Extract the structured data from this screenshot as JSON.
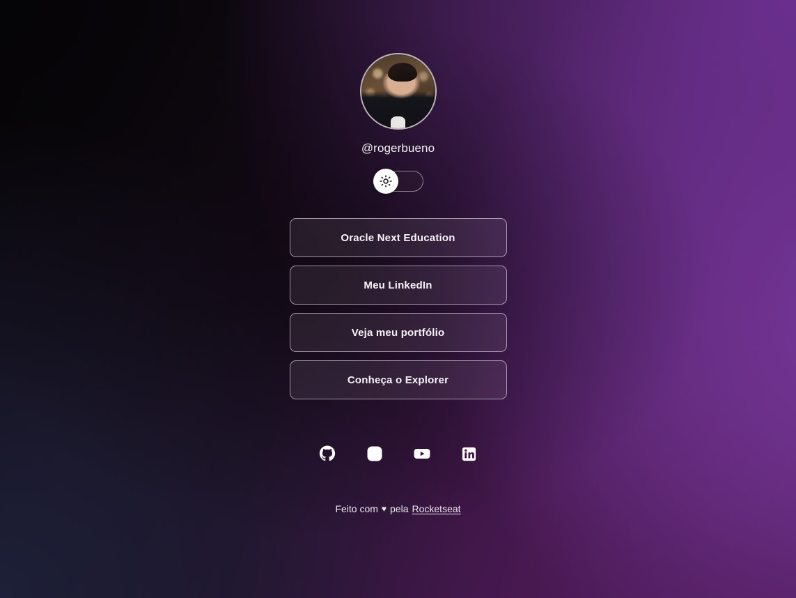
{
  "theme": {
    "accent": "#5a2a7a",
    "background_top_left": "#050406",
    "background_top_right": "#5a2a7a",
    "background_bottom_left": "#191b2e",
    "background_bottom_right": "#44164c",
    "text_color": "#f3f0f5"
  },
  "profile": {
    "username": "@rogerbueno",
    "avatar_alt": "profile-photo"
  },
  "theme_switch": {
    "icon": "sun-icon",
    "state": "light",
    "aria_label": "Alternar tema"
  },
  "links": [
    {
      "label": "Oracle Next Education",
      "name": "link-oracle-next-education"
    },
    {
      "label": "Meu LinkedIn",
      "name": "link-meu-linkedin"
    },
    {
      "label": "Veja meu portfólio",
      "name": "link-veja-meu-portfolio"
    },
    {
      "label": "Conheça o Explorer",
      "name": "link-conheca-o-explorer"
    }
  ],
  "social": [
    {
      "icon": "github-icon",
      "name": "social-link-github"
    },
    {
      "icon": "instagram-icon",
      "name": "social-link-instagram"
    },
    {
      "icon": "youtube-icon",
      "name": "social-link-youtube"
    },
    {
      "icon": "linkedin-icon",
      "name": "social-link-linkedin"
    }
  ],
  "footer": {
    "prefix": "Feito com",
    "heart": "♥",
    "middle": "pela",
    "link_label": "Rocketseat"
  }
}
